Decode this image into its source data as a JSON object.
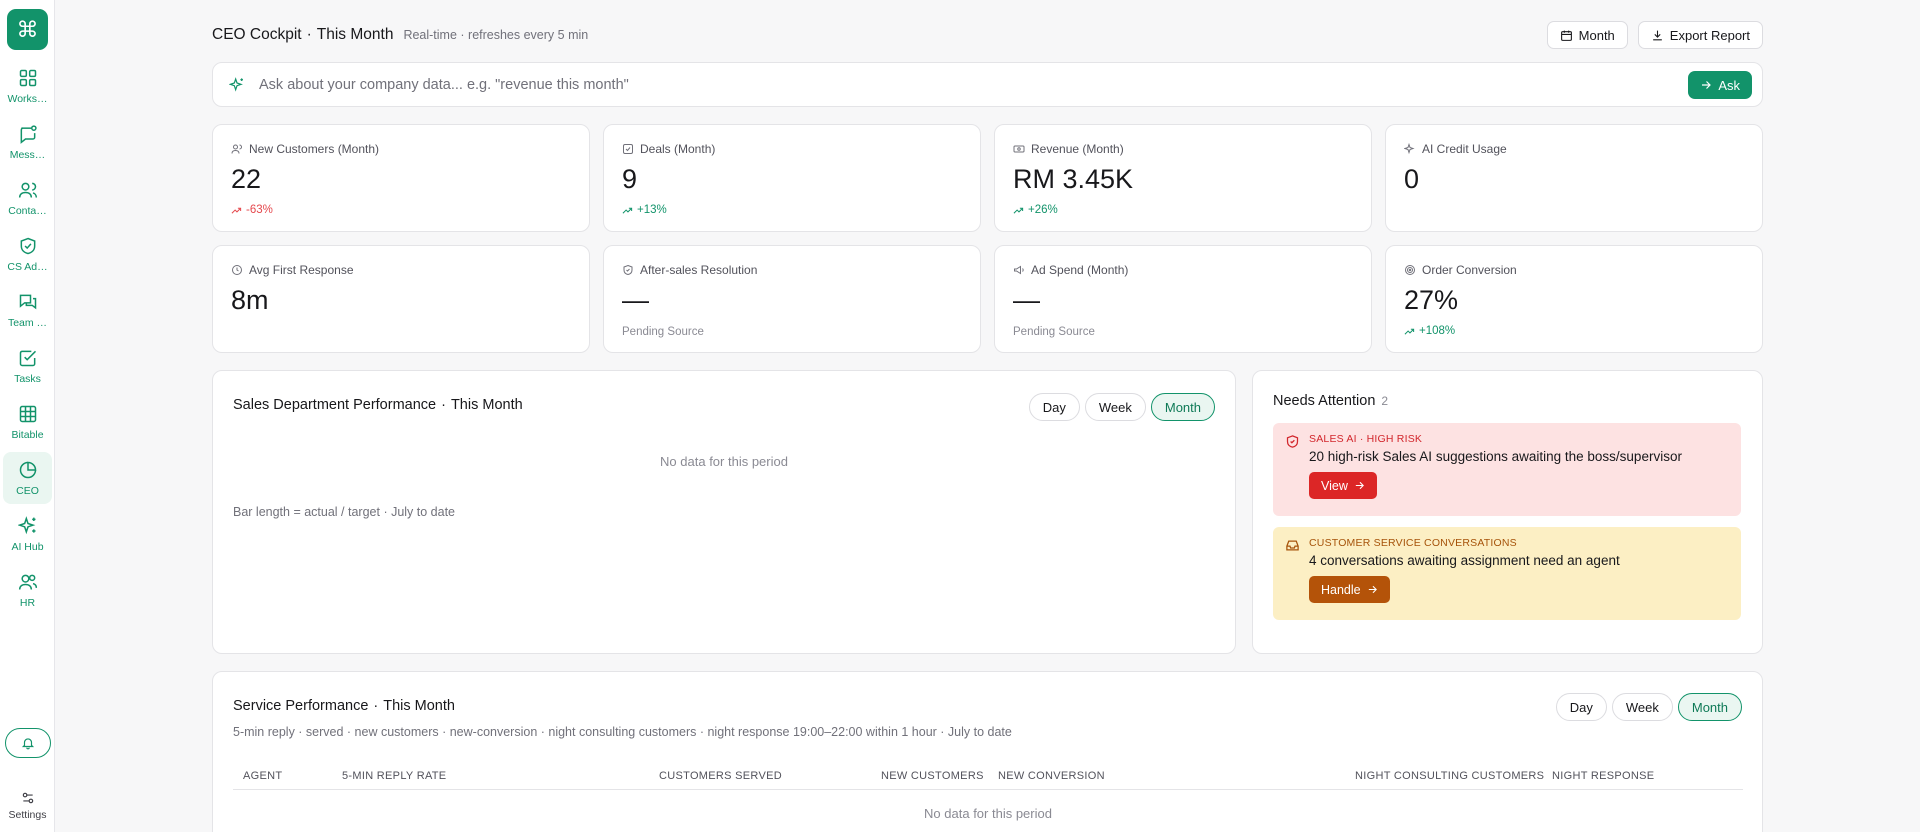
{
  "sidebar": {
    "logo_glyph": "⌘",
    "items": [
      {
        "label": "Works…",
        "icon": "grid-icon"
      },
      {
        "label": "Mess…",
        "icon": "message-icon"
      },
      {
        "label": "Conta…",
        "icon": "users-icon"
      },
      {
        "label": "CS Ad…",
        "icon": "shield-check-icon"
      },
      {
        "label": "Team …",
        "icon": "chat-bubbles-icon"
      },
      {
        "label": "Tasks",
        "icon": "checkbox-icon"
      },
      {
        "label": "Bitable",
        "icon": "table-icon"
      },
      {
        "label": "CEO",
        "icon": "pie-chart-icon"
      },
      {
        "label": "AI Hub",
        "icon": "sparkles-icon"
      },
      {
        "label": "HR",
        "icon": "people-icon"
      }
    ],
    "active_index": 7,
    "settings_label": "Settings"
  },
  "header": {
    "title": "CEO Cockpit",
    "title_suffix": "This Month",
    "subtitle": "Real-time · refreshes every 5 min",
    "period_button": "Month",
    "export_button": "Export Report"
  },
  "ask": {
    "placeholder": "Ask about your company data... e.g. \"revenue this month\"",
    "button": "Ask"
  },
  "kpis": [
    {
      "label": "New Customers (Month)",
      "value": "22",
      "delta": "-63%",
      "trend": "down",
      "icon": "users-icon"
    },
    {
      "label": "Deals (Month)",
      "value": "9",
      "delta": "+13%",
      "trend": "up",
      "icon": "checkbox-icon"
    },
    {
      "label": "Revenue (Month)",
      "value": "RM 3.45K",
      "delta": "+26%",
      "trend": "up",
      "icon": "banknote-icon"
    },
    {
      "label": "AI Credit Usage",
      "value": "0",
      "icon": "sparkles-icon"
    },
    {
      "label": "Avg First Response",
      "value": "8m",
      "icon": "clock-icon"
    },
    {
      "label": "After-sales Resolution",
      "value": "—",
      "sub": "Pending Source",
      "icon": "shield-icon"
    },
    {
      "label": "Ad Spend (Month)",
      "value": "—",
      "sub": "Pending Source",
      "icon": "megaphone-icon"
    },
    {
      "label": "Order Conversion",
      "value": "27%",
      "delta": "+108%",
      "trend": "up",
      "icon": "target-icon"
    }
  ],
  "sales": {
    "title": "Sales Department Performance",
    "title_suffix": "This Month",
    "ranges": [
      "Day",
      "Week",
      "Month"
    ],
    "active_range": "Month",
    "empty": "No data for this period",
    "note": "Bar length = actual / target · July to date"
  },
  "attention": {
    "title": "Needs Attention",
    "count": "2",
    "alerts": [
      {
        "tag": "SALES AI · HIGH RISK",
        "text": "20 high-risk Sales AI suggestions awaiting the boss/supervisor",
        "button": "View",
        "tone": "red"
      },
      {
        "tag": "CUSTOMER SERVICE CONVERSATIONS",
        "text": "4 conversations awaiting assignment need an agent",
        "button": "Handle",
        "tone": "yellow"
      }
    ]
  },
  "service": {
    "title": "Service Performance",
    "title_suffix": "This Month",
    "subtitle": "5-min reply · served · new customers · new-conversion · night consulting customers · night response 19:00–22:00 within 1 hour · July to date",
    "ranges": [
      "Day",
      "Week",
      "Month"
    ],
    "active_range": "Month",
    "columns": [
      "AGENT",
      "5-MIN REPLY RATE",
      "CUSTOMERS SERVED",
      "NEW CUSTOMERS",
      "NEW CONVERSION",
      "NIGHT CONSULTING CUSTOMERS",
      "NIGHT RESPONSE"
    ],
    "empty": "No data for this period"
  },
  "colors": {
    "accent": "#12936a",
    "danger": "#dc2626",
    "warning": "#b45309"
  }
}
